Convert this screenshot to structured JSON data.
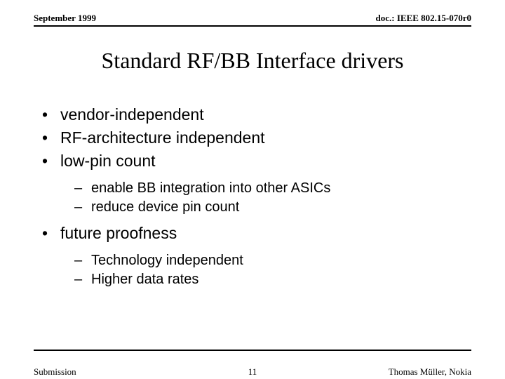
{
  "header": {
    "left": "September 1999",
    "right": "doc.: IEEE 802.15-070r0"
  },
  "title": "Standard RF/BB Interface drivers",
  "bullets": {
    "b0": "vendor-independent",
    "b1": "RF-architecture independent",
    "b2": "low-pin count",
    "s0": "enable BB integration into other ASICs",
    "s1": "reduce device pin count",
    "b3": "future proofness",
    "s2": "Technology independent",
    "s3": "Higher data rates"
  },
  "footer": {
    "left": "Submission",
    "center": "11",
    "right": "Thomas Müller, Nokia"
  }
}
